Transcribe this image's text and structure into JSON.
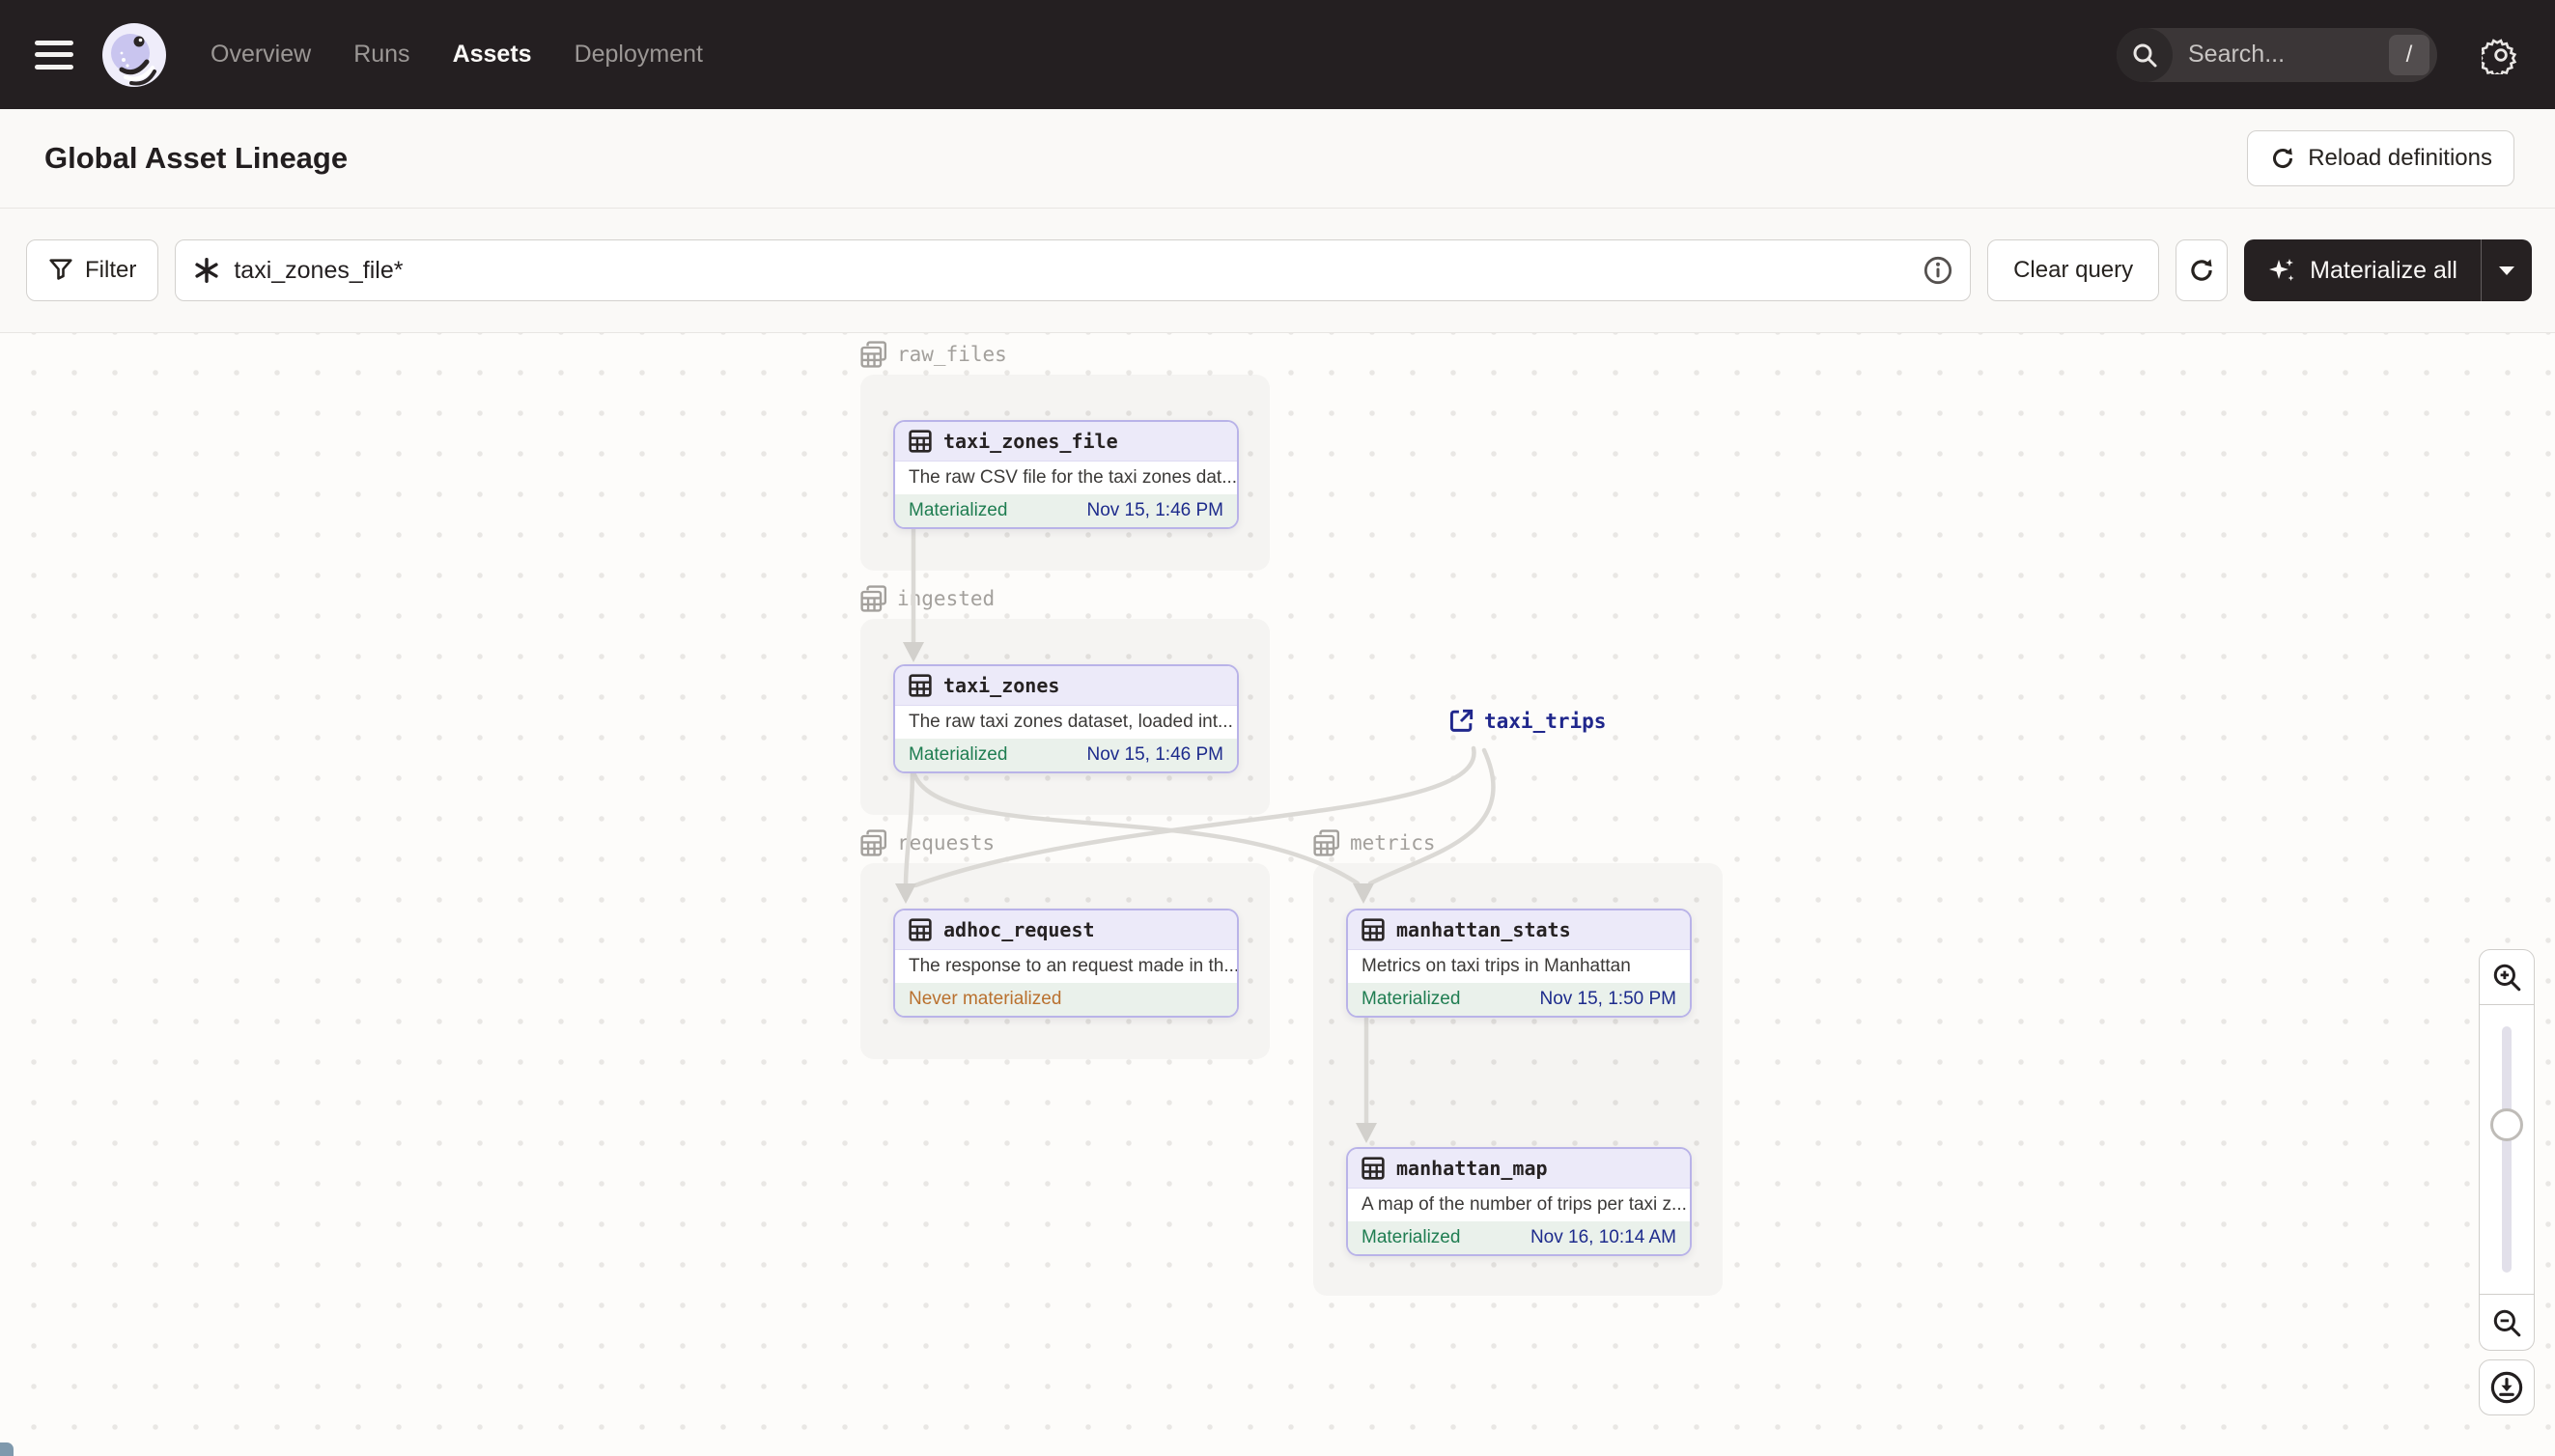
{
  "nav": {
    "items": [
      {
        "label": "Overview",
        "active": false
      },
      {
        "label": "Runs",
        "active": false
      },
      {
        "label": "Assets",
        "active": true
      },
      {
        "label": "Deployment",
        "active": false
      }
    ],
    "search_placeholder": "Search...",
    "search_shortcut": "/"
  },
  "header": {
    "title": "Global Asset Lineage",
    "reload_label": "Reload definitions"
  },
  "toolbar": {
    "filter_label": "Filter",
    "query_value": "taxi_zones_file*",
    "clear_label": "Clear query",
    "materialize_label": "Materialize all"
  },
  "graph": {
    "groups": [
      {
        "name": "raw_files"
      },
      {
        "name": "ingested"
      },
      {
        "name": "requests"
      },
      {
        "name": "metrics"
      }
    ],
    "nodes": [
      {
        "name": "taxi_zones_file",
        "description": "The raw CSV file for the taxi zones dat...",
        "status": "Materialized",
        "timestamp": "Nov 15, 1:46 PM"
      },
      {
        "name": "taxi_zones",
        "description": "The raw taxi zones dataset, loaded int...",
        "status": "Materialized",
        "timestamp": "Nov 15, 1:46 PM"
      },
      {
        "name": "adhoc_request",
        "description": "The response to an request made in th...",
        "status": "Never materialized",
        "timestamp": ""
      },
      {
        "name": "manhattan_stats",
        "description": "Metrics on taxi trips in Manhattan",
        "status": "Materialized",
        "timestamp": "Nov 15, 1:50 PM"
      },
      {
        "name": "manhattan_map",
        "description": "A map of the number of trips per taxi z...",
        "status": "Materialized",
        "timestamp": "Nov 16, 10:14 AM"
      }
    ],
    "external_node": {
      "name": "taxi_trips"
    }
  },
  "icons": {
    "menu": "hamburger",
    "logo": "dagster-octopus",
    "search": "magnifier",
    "settings": "gear",
    "reload": "circular-arrow",
    "filter": "funnel",
    "query": "asterisk-graph",
    "info": "circled-i",
    "refresh": "circular-arrow",
    "materialize": "sparkle",
    "caret": "triangle-down",
    "asset": "table-grid",
    "group": "table-stack",
    "external": "external-link",
    "zoom_in": "magnifier-plus",
    "zoom_out": "magnifier-minus",
    "download": "circled-down-arrow"
  },
  "colors": {
    "nav_bg": "#241F21",
    "accent_purple_border": "#B9B3E8",
    "node_header_purple": "#ECEAF9",
    "status_green": "#1F7D51",
    "timestamp_navy": "#1D2B8C",
    "warning_orange": "#B9702E",
    "external_navy": "#20278C",
    "edge_gray": "#DBD9D5"
  }
}
